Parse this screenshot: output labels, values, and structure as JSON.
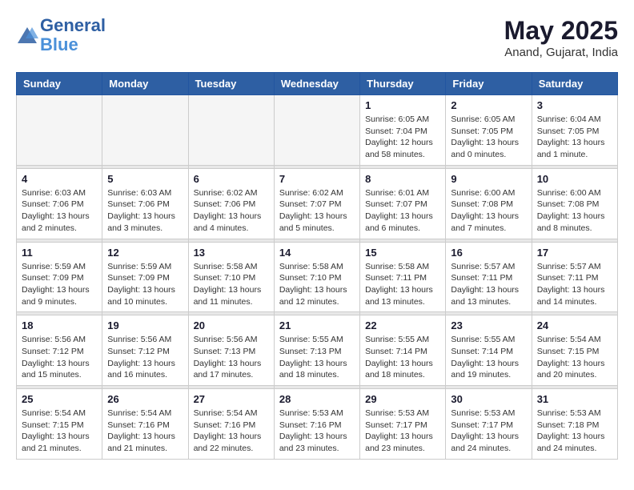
{
  "header": {
    "logo_line1": "General",
    "logo_line2": "Blue",
    "month_year": "May 2025",
    "location": "Anand, Gujarat, India"
  },
  "days_of_week": [
    "Sunday",
    "Monday",
    "Tuesday",
    "Wednesday",
    "Thursday",
    "Friday",
    "Saturday"
  ],
  "weeks": [
    [
      {
        "num": "",
        "info": ""
      },
      {
        "num": "",
        "info": ""
      },
      {
        "num": "",
        "info": ""
      },
      {
        "num": "",
        "info": ""
      },
      {
        "num": "1",
        "info": "Sunrise: 6:05 AM\nSunset: 7:04 PM\nDaylight: 12 hours\nand 58 minutes."
      },
      {
        "num": "2",
        "info": "Sunrise: 6:05 AM\nSunset: 7:05 PM\nDaylight: 13 hours\nand 0 minutes."
      },
      {
        "num": "3",
        "info": "Sunrise: 6:04 AM\nSunset: 7:05 PM\nDaylight: 13 hours\nand 1 minute."
      }
    ],
    [
      {
        "num": "4",
        "info": "Sunrise: 6:03 AM\nSunset: 7:06 PM\nDaylight: 13 hours\nand 2 minutes."
      },
      {
        "num": "5",
        "info": "Sunrise: 6:03 AM\nSunset: 7:06 PM\nDaylight: 13 hours\nand 3 minutes."
      },
      {
        "num": "6",
        "info": "Sunrise: 6:02 AM\nSunset: 7:06 PM\nDaylight: 13 hours\nand 4 minutes."
      },
      {
        "num": "7",
        "info": "Sunrise: 6:02 AM\nSunset: 7:07 PM\nDaylight: 13 hours\nand 5 minutes."
      },
      {
        "num": "8",
        "info": "Sunrise: 6:01 AM\nSunset: 7:07 PM\nDaylight: 13 hours\nand 6 minutes."
      },
      {
        "num": "9",
        "info": "Sunrise: 6:00 AM\nSunset: 7:08 PM\nDaylight: 13 hours\nand 7 minutes."
      },
      {
        "num": "10",
        "info": "Sunrise: 6:00 AM\nSunset: 7:08 PM\nDaylight: 13 hours\nand 8 minutes."
      }
    ],
    [
      {
        "num": "11",
        "info": "Sunrise: 5:59 AM\nSunset: 7:09 PM\nDaylight: 13 hours\nand 9 minutes."
      },
      {
        "num": "12",
        "info": "Sunrise: 5:59 AM\nSunset: 7:09 PM\nDaylight: 13 hours\nand 10 minutes."
      },
      {
        "num": "13",
        "info": "Sunrise: 5:58 AM\nSunset: 7:10 PM\nDaylight: 13 hours\nand 11 minutes."
      },
      {
        "num": "14",
        "info": "Sunrise: 5:58 AM\nSunset: 7:10 PM\nDaylight: 13 hours\nand 12 minutes."
      },
      {
        "num": "15",
        "info": "Sunrise: 5:58 AM\nSunset: 7:11 PM\nDaylight: 13 hours\nand 13 minutes."
      },
      {
        "num": "16",
        "info": "Sunrise: 5:57 AM\nSunset: 7:11 PM\nDaylight: 13 hours\nand 13 minutes."
      },
      {
        "num": "17",
        "info": "Sunrise: 5:57 AM\nSunset: 7:11 PM\nDaylight: 13 hours\nand 14 minutes."
      }
    ],
    [
      {
        "num": "18",
        "info": "Sunrise: 5:56 AM\nSunset: 7:12 PM\nDaylight: 13 hours\nand 15 minutes."
      },
      {
        "num": "19",
        "info": "Sunrise: 5:56 AM\nSunset: 7:12 PM\nDaylight: 13 hours\nand 16 minutes."
      },
      {
        "num": "20",
        "info": "Sunrise: 5:56 AM\nSunset: 7:13 PM\nDaylight: 13 hours\nand 17 minutes."
      },
      {
        "num": "21",
        "info": "Sunrise: 5:55 AM\nSunset: 7:13 PM\nDaylight: 13 hours\nand 18 minutes."
      },
      {
        "num": "22",
        "info": "Sunrise: 5:55 AM\nSunset: 7:14 PM\nDaylight: 13 hours\nand 18 minutes."
      },
      {
        "num": "23",
        "info": "Sunrise: 5:55 AM\nSunset: 7:14 PM\nDaylight: 13 hours\nand 19 minutes."
      },
      {
        "num": "24",
        "info": "Sunrise: 5:54 AM\nSunset: 7:15 PM\nDaylight: 13 hours\nand 20 minutes."
      }
    ],
    [
      {
        "num": "25",
        "info": "Sunrise: 5:54 AM\nSunset: 7:15 PM\nDaylight: 13 hours\nand 21 minutes."
      },
      {
        "num": "26",
        "info": "Sunrise: 5:54 AM\nSunset: 7:16 PM\nDaylight: 13 hours\nand 21 minutes."
      },
      {
        "num": "27",
        "info": "Sunrise: 5:54 AM\nSunset: 7:16 PM\nDaylight: 13 hours\nand 22 minutes."
      },
      {
        "num": "28",
        "info": "Sunrise: 5:53 AM\nSunset: 7:16 PM\nDaylight: 13 hours\nand 23 minutes."
      },
      {
        "num": "29",
        "info": "Sunrise: 5:53 AM\nSunset: 7:17 PM\nDaylight: 13 hours\nand 23 minutes."
      },
      {
        "num": "30",
        "info": "Sunrise: 5:53 AM\nSunset: 7:17 PM\nDaylight: 13 hours\nand 24 minutes."
      },
      {
        "num": "31",
        "info": "Sunrise: 5:53 AM\nSunset: 7:18 PM\nDaylight: 13 hours\nand 24 minutes."
      }
    ]
  ]
}
